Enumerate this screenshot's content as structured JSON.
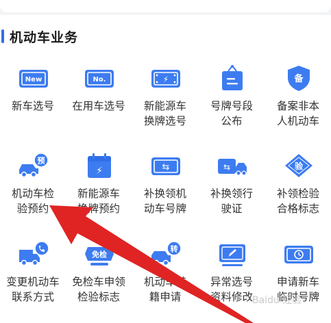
{
  "section": {
    "title": "机动车业务"
  },
  "colors": {
    "accent": "#2f6fe8",
    "arrow": "#e02424"
  },
  "rows": [
    [
      {
        "label": "新车选号",
        "icon": "new-plate-icon",
        "icon_text": "New"
      },
      {
        "label": "在用车选号",
        "icon": "no-plate-icon",
        "icon_text": "No."
      },
      {
        "label": "新能源车\n换牌选号",
        "icon": "ev-plate-icon",
        "icon_text": "⚡"
      },
      {
        "label": "号牌号段\n公布",
        "icon": "announcement-board-icon",
        "icon_text": ""
      },
      {
        "label": "备案非本\n人机动车",
        "icon": "record-shield-icon",
        "icon_text": "备"
      }
    ],
    [
      {
        "label": "机动车检\n验预约",
        "icon": "car-inspection-icon",
        "icon_text": "预"
      },
      {
        "label": "新能源车\n换牌预约",
        "icon": "ev-calendar-icon",
        "icon_text": "⚡"
      },
      {
        "label": "补换领机\n动车号牌",
        "icon": "plate-exchange-icon",
        "icon_text": "⇆"
      },
      {
        "label": "补换领行\n驶证",
        "icon": "license-exchange-icon",
        "icon_text": "⇆"
      },
      {
        "label": "补领检验\n合格标志",
        "icon": "inspection-badge-icon",
        "icon_text": "验"
      }
    ],
    [
      {
        "label": "变更机动车\n联系方式",
        "icon": "truck-phone-icon",
        "icon_text": ""
      },
      {
        "label": "免检车申领\n检验标志",
        "icon": "exempt-car-icon",
        "icon_text": "免检"
      },
      {
        "label": "机动车转\n籍申请",
        "icon": "car-transfer-icon",
        "icon_text": "转"
      },
      {
        "label": "异常选号\n资料修改",
        "icon": "edit-screen-icon",
        "icon_text": ""
      },
      {
        "label": "申请新车\n临时号牌",
        "icon": "temporary-plate-icon",
        "icon_text": ""
      }
    ]
  ],
  "watermark": "Baidu 经验"
}
